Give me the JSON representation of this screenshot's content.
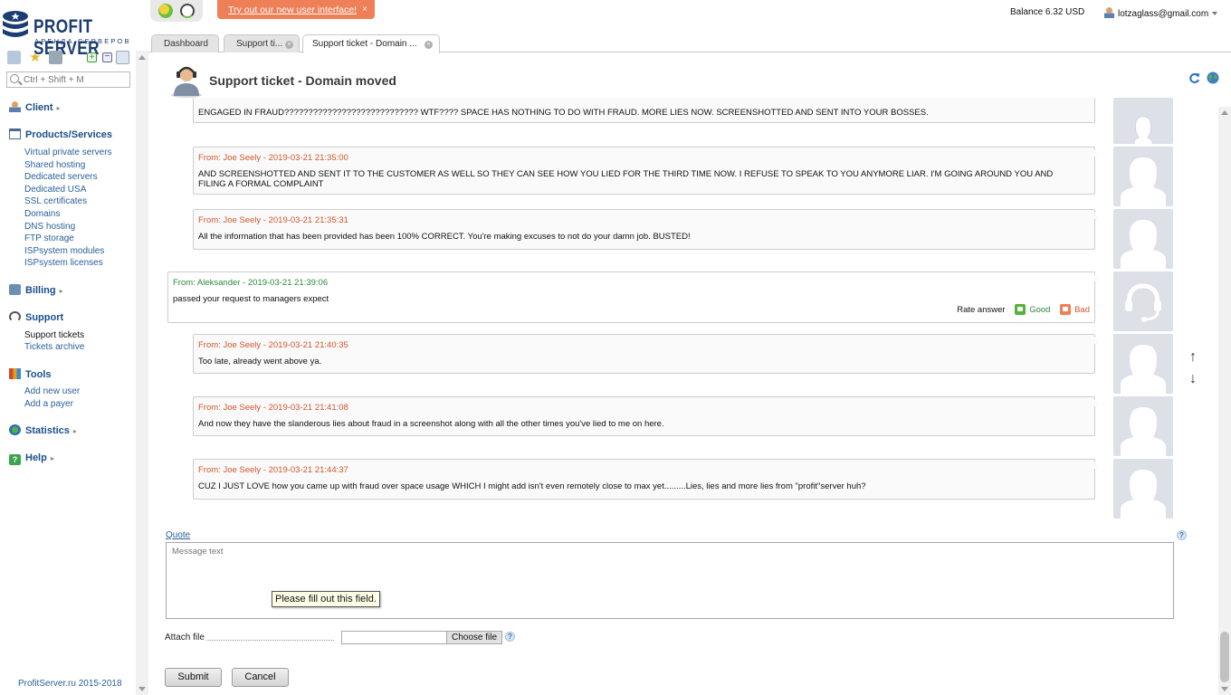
{
  "brand": {
    "name": "PROFIT SERVER",
    "tagline": "АРЕНДА СЕРВЕРОВ"
  },
  "search": {
    "placeholder": "Ctrl + Shift + M"
  },
  "nav": {
    "client": "Client",
    "products": "Products/Services",
    "products_items": [
      "Virtual private servers",
      "Shared hosting",
      "Dedicated servers",
      "Dedicated USA",
      "SSL certificates",
      "Domains",
      "DNS hosting",
      "FTP storage",
      "ISPsystem modules",
      "ISPsystem licenses"
    ],
    "billing": "Billing",
    "support": "Support",
    "support_items": [
      "Support tickets",
      "Tickets archive"
    ],
    "tools": "Tools",
    "tools_items": [
      "Add new user",
      "Add a payer"
    ],
    "statistics": "Statistics",
    "help": "Help"
  },
  "copyright": "ProfitServer.ru 2015-2018",
  "promo": {
    "text": "Try out our new user interface!",
    "close": "×"
  },
  "balance": "Balance 6.32 USD",
  "user_email": "lotzaglass@gmail.com",
  "tabs": [
    "Dashboard",
    "Support ti...",
    "Support ticket - Domain ..."
  ],
  "page_title": "Support ticket - Domain moved",
  "messages": [
    {
      "from": "",
      "body": "ENGAGED IN FRAUD???????????????????????????? WTF???? SPACE HAS NOTHING TO DO WITH FRAUD. MORE LIES NOW. SCREENSHOTTED AND SENT INTO YOUR BOSSES."
    },
    {
      "from": "From: Joe Seely - 2019-03-21 21:35:00",
      "body": "AND SCREENSHOTTED AND SENT IT TO THE CUSTOMER AS WELL SO THEY CAN SEE HOW YOU LIED FOR THE THIRD TIME NOW. I REFUSE TO SPEAK TO YOU ANYMORE LIAR. I'M GOING AROUND YOU AND FILING A FORMAL COMPLAINT"
    },
    {
      "from": "From: Joe Seely - 2019-03-21 21:35:31",
      "body": "All the information that has been provided has been 100% CORRECT. You're making excuses to not do your damn job. BUSTED!"
    },
    {
      "from": "From: Aleksander - 2019-03-21 21:39:06",
      "body": "passed your request to managers expect",
      "rate_label": "Rate answer",
      "good": "Good",
      "bad": "Bad"
    },
    {
      "from": "From: Joe Seely - 2019-03-21 21:40:35",
      "body": "Too late, already went above ya."
    },
    {
      "from": "From: Joe Seely - 2019-03-21 21:41:08",
      "body": "And now they have the slanderous lies about fraud in a screenshot along with all the other times you've lied to me on here."
    },
    {
      "from": "From: Joe Seely - 2019-03-21 21:44:37",
      "body": "CUZ I JUST LOVE how you came up with fraud over space usage WHICH I might add isn't even remotely close to max yet.........Lies, lies and more lies from \"profit\"server huh?"
    }
  ],
  "form": {
    "quote": "Quote",
    "message_placeholder": "Message text",
    "validation_tooltip": "Please fill out this field.",
    "attach_label": "Attach file",
    "choose_file": "Choose file",
    "submit": "Submit",
    "cancel": "Cancel",
    "help": "?"
  },
  "colors": {
    "brand_blue": "#1b3d73",
    "link_blue": "#2a5f99",
    "customer_orange": "#d2562b",
    "staff_green": "#2f8a3d",
    "promo_bg": "#ef7f56"
  }
}
